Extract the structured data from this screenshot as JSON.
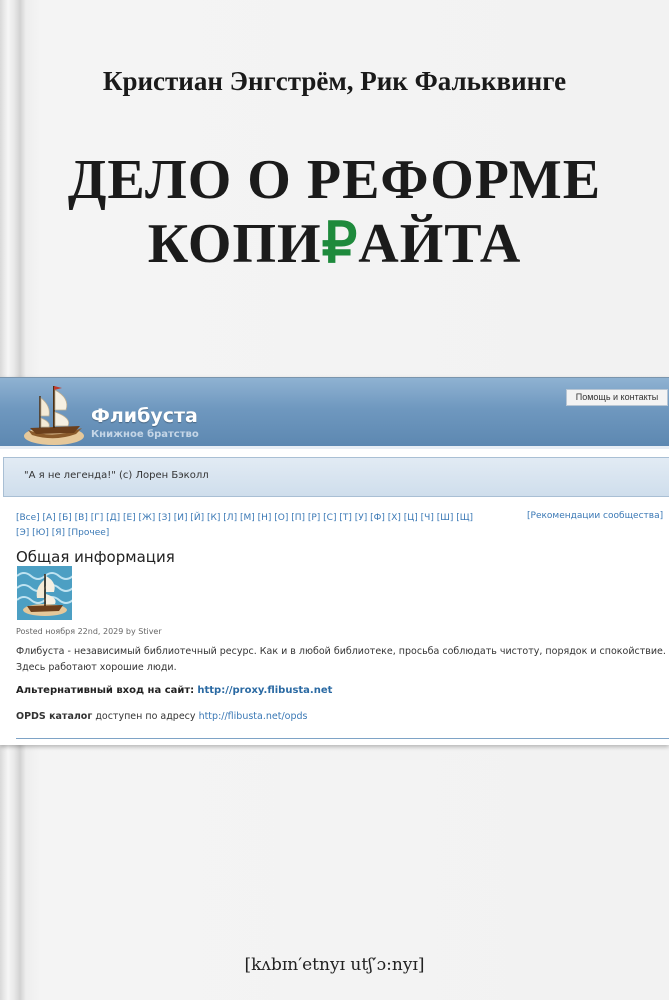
{
  "cover": {
    "authors": "Кристиан Энгстрём, Рик Фальквинге",
    "title_line1": "ДЕЛО О РЕФОРМЕ",
    "title_line2_pre": "КОПИ",
    "title_line2_symbol": "₽",
    "title_line2_post": "АЙТА",
    "publisher": "[kʌbɪn′etnyɪ utʃ′ɔ:nyɪ]",
    "accent_color": "#1e8a3c"
  },
  "site": {
    "name": "Флибуста",
    "slogan": "Книжное братство",
    "help_link": "Помощь и контакты",
    "quote": "\"А я не легенда!\" (с) Лорен Бэколл",
    "alphabet_line1": "[Все] [А] [Б] [В] [Г] [Д] [Е] [Ж] [З] [И] [Й] [К] [Л] [М] [Н] [О] [П] [Р] [С] [Т] [У] [Ф] [Х] [Ц] [Ч] [Ш] [Щ]",
    "alphabet_line2": "[Э] [Ю] [Я] [Прочее]",
    "recommendations": "[Рекомендации сообщества]",
    "section_title": "Общая информация",
    "posted": "Posted ноября 22nd, 2029 by Stiver",
    "description": "Флибуста - независимый библиотечный ресурс. Как и в любой библиотеке, просьба соблюдать чистоту, порядок и спокойствие. Здесь работают хорошие люди.",
    "alt_label": "Альтернативный вход на сайт:",
    "alt_url": "http://proxy.flibusta.net",
    "opds_label": "OPDS каталог",
    "opds_text": "доступен по адресу",
    "opds_url": "http://flibusta.net/opds",
    "header_color": "#6f98bf",
    "link_color": "#3a78b5"
  }
}
